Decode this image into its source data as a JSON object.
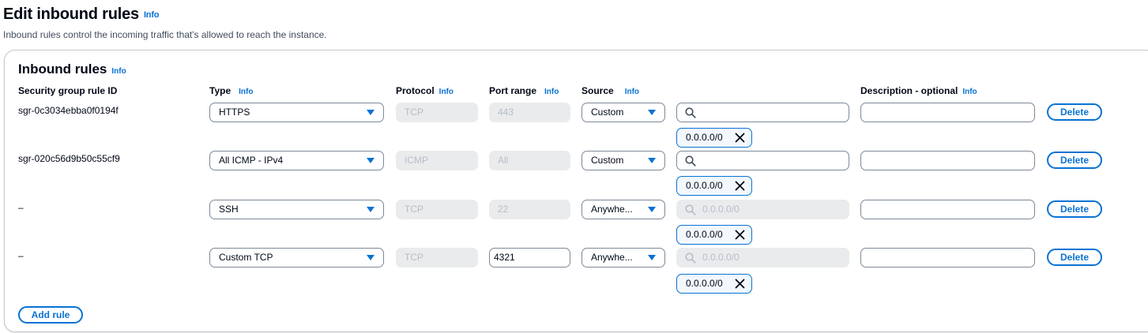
{
  "header": {
    "title": "Edit inbound rules",
    "info": "Info",
    "description": "Inbound rules control the incoming traffic that's allowed to reach the instance."
  },
  "panel": {
    "title": "Inbound rules",
    "info": "Info",
    "columns": {
      "rule_id": "Security group rule ID",
      "type": "Type",
      "type_info": "Info",
      "protocol": "Protocol",
      "protocol_info": "Info",
      "port_range": "Port range",
      "port_range_info": "Info",
      "source": "Source",
      "source_info": "Info",
      "description": "Description - optional",
      "description_info": "Info"
    },
    "rows": [
      {
        "rule_id": "sgr-0c3034ebba0f0194f",
        "type": "HTTPS",
        "protocol": "TCP",
        "port_range": "443",
        "source": "Custom",
        "search_placeholder": "",
        "token": "0.0.0.0/0",
        "description": "",
        "delete_label": "Delete"
      },
      {
        "rule_id": "sgr-020c56d9b50c55cf9",
        "type": "All ICMP - IPv4",
        "protocol": "ICMP",
        "port_range": "All",
        "source": "Custom",
        "search_placeholder": "",
        "token": "0.0.0.0/0",
        "description": "",
        "delete_label": "Delete"
      },
      {
        "rule_id": "–",
        "type": "SSH",
        "protocol": "TCP",
        "port_range": "22",
        "source": "Anywhe...",
        "search_placeholder": "0.0.0.0/0",
        "token": "0.0.0.0/0",
        "description": "",
        "delete_label": "Delete"
      },
      {
        "rule_id": "–",
        "type": "Custom TCP",
        "protocol": "TCP",
        "port_range": "4321",
        "source": "Anywhe...",
        "search_placeholder": "0.0.0.0/0",
        "token": "0.0.0.0/0",
        "description": "",
        "delete_label": "Delete"
      }
    ],
    "add_rule_label": "Add rule"
  },
  "colors": {
    "accent": "#0972d3",
    "text": "#000716",
    "disabled_bg": "#e9ebed",
    "disabled_text": "#b6bec9"
  },
  "icons": {
    "dropdown": "caret-down-icon",
    "search": "search-icon",
    "remove": "close-icon"
  }
}
